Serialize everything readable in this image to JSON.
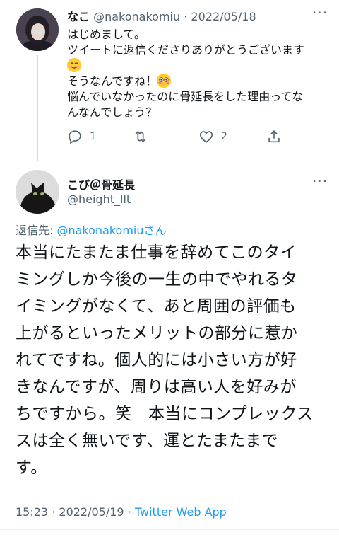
{
  "reply_tweet": {
    "author_name": "なこ",
    "author_handle": "@nakonakomiu",
    "separator": "·",
    "date": "2022/05/18",
    "more_label": "···",
    "lines": [
      "はじめまして。",
      "ツイートに返信くださりありがとうございます",
      "",
      "そうなんですね！",
      "悩んでいなかったのに骨延長をした理由ってな",
      "んなんでしょう？"
    ],
    "actions": {
      "reply_icon": "reply-icon",
      "reply_count": "1",
      "retweet_icon": "retweet-icon",
      "retweet_count": "",
      "like_icon": "heart-icon",
      "like_count": "2",
      "share_icon": "share-icon"
    }
  },
  "main_tweet": {
    "author_name": "こび＠骨延長",
    "author_handle": "@height_llt",
    "more_label": "···",
    "reply_to_prefix": "返信先: ",
    "reply_to_handle": "@nakonakomiu",
    "reply_to_suffix": "さん",
    "lines": [
      "本当にたまたま仕事を辞めてこのタイ",
      "ミングしか今後の一生の中でやれるタ",
      "イミングがなくて、あと周囲の評価も",
      "上がるといったメリットの部分に惹か",
      "れてですね。個人的には小さい方が好",
      "きなんですが、周りは高い人を好みが",
      "ちですから。笑　本当にコンプレックス",
      "スは全く無いです、運とたまたまで",
      "す。"
    ],
    "time": "15:23",
    "separator": "·",
    "date": "2022/05/19",
    "source": "Twitter Web App"
  },
  "colors": {
    "link": "#1d9bf0",
    "secondary_text": "#536471",
    "primary_text": "#0f1419",
    "divider": "#eff3f4"
  }
}
